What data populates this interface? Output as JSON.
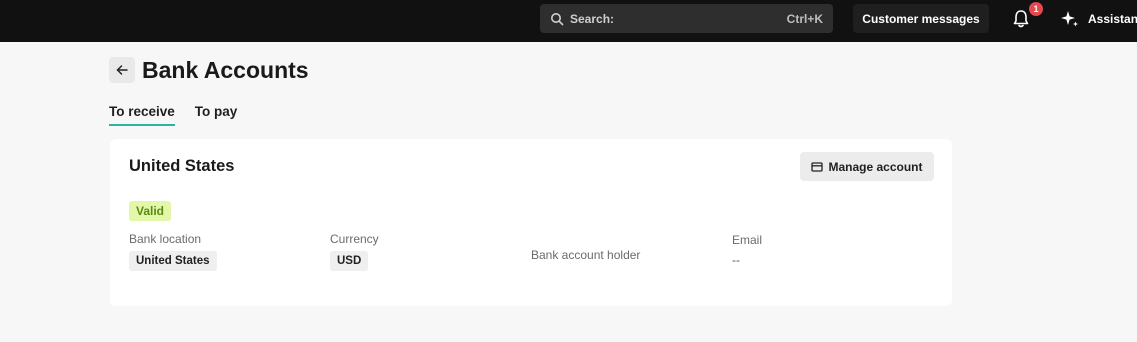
{
  "topbar": {
    "search_placeholder": "Search:",
    "search_shortcut": "Ctrl+K",
    "customer_messages_label": "Customer messages",
    "notification_count": "1",
    "assistant_label": "Assistant"
  },
  "page": {
    "title": "Bank Accounts",
    "tabs": [
      {
        "label": "To receive",
        "active": true
      },
      {
        "label": "To pay",
        "active": false
      }
    ]
  },
  "account": {
    "country": "United States",
    "manage_label": "Manage account",
    "status": "Valid",
    "fields": {
      "bank_location_label": "Bank location",
      "bank_location_value": "United States",
      "currency_label": "Currency",
      "currency_value": "USD",
      "holder_label": "Bank account holder",
      "email_label": "Email",
      "email_value": "--"
    }
  },
  "colors": {
    "topbar_bg": "#111111",
    "tab_underline": "#2bb3a3",
    "valid_badge_bg": "#e3f7a8",
    "notification_badge": "#e5484d"
  }
}
